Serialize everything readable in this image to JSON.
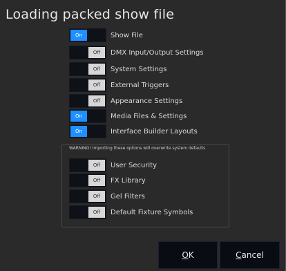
{
  "dialog": {
    "title": "Loading packed show file"
  },
  "options": [
    {
      "state": "On",
      "on": true,
      "label": "Show File"
    },
    {
      "state": "Off",
      "on": false,
      "label": "DMX Input/Output Settings"
    },
    {
      "state": "Off",
      "on": false,
      "label": "System Settings"
    },
    {
      "state": "Off",
      "on": false,
      "label": "External Triggers"
    },
    {
      "state": "Off",
      "on": false,
      "label": "Appearance Settings"
    },
    {
      "state": "On",
      "on": true,
      "label": "Media Files & Settings"
    },
    {
      "state": "On",
      "on": true,
      "label": "Interface Builder Layouts"
    }
  ],
  "warning": {
    "text": "WARNING! Importing these options will overwrite system defaults",
    "options": [
      {
        "state": "Off",
        "on": false,
        "label": "User Security"
      },
      {
        "state": "Off",
        "on": false,
        "label": "FX Library"
      },
      {
        "state": "Off",
        "on": false,
        "label": "Gel Filters"
      },
      {
        "state": "Off",
        "on": false,
        "label": "Default Fixture Symbols"
      }
    ]
  },
  "buttons": {
    "ok_mnemonic": "O",
    "ok_rest": "K",
    "cancel_mnemonic": "C",
    "cancel_rest": "ancel"
  },
  "colors": {
    "toggle_on": "#1e90ff",
    "toggle_off": "#d7d7d7",
    "background": "#2a2a2a"
  }
}
